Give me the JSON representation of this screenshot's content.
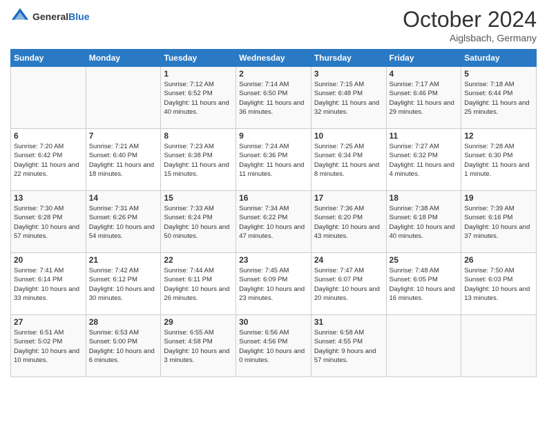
{
  "header": {
    "logo_line1": "General",
    "logo_line2": "Blue",
    "month": "October 2024",
    "location": "Aiglsbach, Germany"
  },
  "days_of_week": [
    "Sunday",
    "Monday",
    "Tuesday",
    "Wednesday",
    "Thursday",
    "Friday",
    "Saturday"
  ],
  "weeks": [
    [
      {
        "day": "",
        "info": ""
      },
      {
        "day": "",
        "info": ""
      },
      {
        "day": "1",
        "info": "Sunrise: 7:12 AM\nSunset: 6:52 PM\nDaylight: 11 hours and 40 minutes."
      },
      {
        "day": "2",
        "info": "Sunrise: 7:14 AM\nSunset: 6:50 PM\nDaylight: 11 hours and 36 minutes."
      },
      {
        "day": "3",
        "info": "Sunrise: 7:15 AM\nSunset: 6:48 PM\nDaylight: 11 hours and 32 minutes."
      },
      {
        "day": "4",
        "info": "Sunrise: 7:17 AM\nSunset: 6:46 PM\nDaylight: 11 hours and 29 minutes."
      },
      {
        "day": "5",
        "info": "Sunrise: 7:18 AM\nSunset: 6:44 PM\nDaylight: 11 hours and 25 minutes."
      }
    ],
    [
      {
        "day": "6",
        "info": "Sunrise: 7:20 AM\nSunset: 6:42 PM\nDaylight: 11 hours and 22 minutes."
      },
      {
        "day": "7",
        "info": "Sunrise: 7:21 AM\nSunset: 6:40 PM\nDaylight: 11 hours and 18 minutes."
      },
      {
        "day": "8",
        "info": "Sunrise: 7:23 AM\nSunset: 6:38 PM\nDaylight: 11 hours and 15 minutes."
      },
      {
        "day": "9",
        "info": "Sunrise: 7:24 AM\nSunset: 6:36 PM\nDaylight: 11 hours and 11 minutes."
      },
      {
        "day": "10",
        "info": "Sunrise: 7:25 AM\nSunset: 6:34 PM\nDaylight: 11 hours and 8 minutes."
      },
      {
        "day": "11",
        "info": "Sunrise: 7:27 AM\nSunset: 6:32 PM\nDaylight: 11 hours and 4 minutes."
      },
      {
        "day": "12",
        "info": "Sunrise: 7:28 AM\nSunset: 6:30 PM\nDaylight: 11 hours and 1 minute."
      }
    ],
    [
      {
        "day": "13",
        "info": "Sunrise: 7:30 AM\nSunset: 6:28 PM\nDaylight: 10 hours and 57 minutes."
      },
      {
        "day": "14",
        "info": "Sunrise: 7:31 AM\nSunset: 6:26 PM\nDaylight: 10 hours and 54 minutes."
      },
      {
        "day": "15",
        "info": "Sunrise: 7:33 AM\nSunset: 6:24 PM\nDaylight: 10 hours and 50 minutes."
      },
      {
        "day": "16",
        "info": "Sunrise: 7:34 AM\nSunset: 6:22 PM\nDaylight: 10 hours and 47 minutes."
      },
      {
        "day": "17",
        "info": "Sunrise: 7:36 AM\nSunset: 6:20 PM\nDaylight: 10 hours and 43 minutes."
      },
      {
        "day": "18",
        "info": "Sunrise: 7:38 AM\nSunset: 6:18 PM\nDaylight: 10 hours and 40 minutes."
      },
      {
        "day": "19",
        "info": "Sunrise: 7:39 AM\nSunset: 6:16 PM\nDaylight: 10 hours and 37 minutes."
      }
    ],
    [
      {
        "day": "20",
        "info": "Sunrise: 7:41 AM\nSunset: 6:14 PM\nDaylight: 10 hours and 33 minutes."
      },
      {
        "day": "21",
        "info": "Sunrise: 7:42 AM\nSunset: 6:12 PM\nDaylight: 10 hours and 30 minutes."
      },
      {
        "day": "22",
        "info": "Sunrise: 7:44 AM\nSunset: 6:11 PM\nDaylight: 10 hours and 26 minutes."
      },
      {
        "day": "23",
        "info": "Sunrise: 7:45 AM\nSunset: 6:09 PM\nDaylight: 10 hours and 23 minutes."
      },
      {
        "day": "24",
        "info": "Sunrise: 7:47 AM\nSunset: 6:07 PM\nDaylight: 10 hours and 20 minutes."
      },
      {
        "day": "25",
        "info": "Sunrise: 7:48 AM\nSunset: 6:05 PM\nDaylight: 10 hours and 16 minutes."
      },
      {
        "day": "26",
        "info": "Sunrise: 7:50 AM\nSunset: 6:03 PM\nDaylight: 10 hours and 13 minutes."
      }
    ],
    [
      {
        "day": "27",
        "info": "Sunrise: 6:51 AM\nSunset: 5:02 PM\nDaylight: 10 hours and 10 minutes."
      },
      {
        "day": "28",
        "info": "Sunrise: 6:53 AM\nSunset: 5:00 PM\nDaylight: 10 hours and 6 minutes."
      },
      {
        "day": "29",
        "info": "Sunrise: 6:55 AM\nSunset: 4:58 PM\nDaylight: 10 hours and 3 minutes."
      },
      {
        "day": "30",
        "info": "Sunrise: 6:56 AM\nSunset: 4:56 PM\nDaylight: 10 hours and 0 minutes."
      },
      {
        "day": "31",
        "info": "Sunrise: 6:58 AM\nSunset: 4:55 PM\nDaylight: 9 hours and 57 minutes."
      },
      {
        "day": "",
        "info": ""
      },
      {
        "day": "",
        "info": ""
      }
    ]
  ]
}
